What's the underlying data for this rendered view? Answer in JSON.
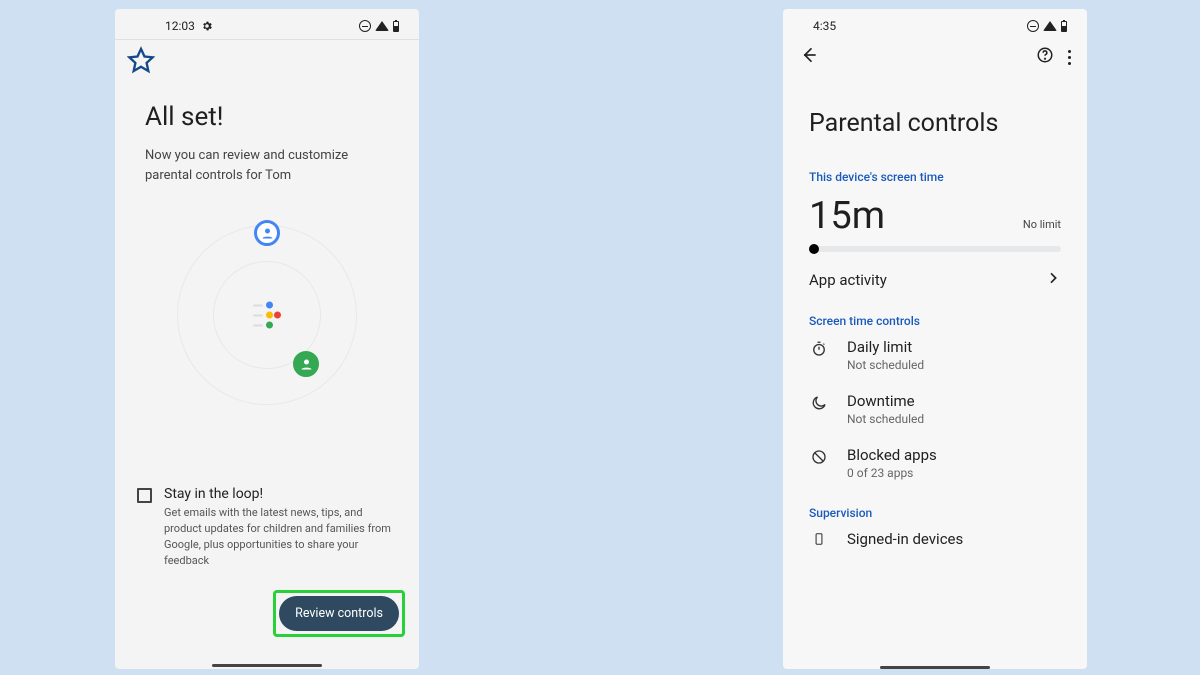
{
  "left": {
    "statusbar": {
      "time": "12:03"
    },
    "title": "All set!",
    "subtitle": "Now you can review and customize parental controls for Tom",
    "opt_in": {
      "heading": "Stay in the loop!",
      "body": "Get emails with the latest news, tips, and product updates for children and families from Google, plus opportunities to share your feedback"
    },
    "review_button": "Review controls"
  },
  "right": {
    "statusbar": {
      "time": "4:35"
    },
    "title": "Parental controls",
    "screen_time_label": "This device's screen time",
    "screen_time_value": "15m",
    "screen_time_limit": "No limit",
    "app_activity": "App activity",
    "controls_label": "Screen time controls",
    "controls": [
      {
        "title": "Daily limit",
        "subtitle": "Not scheduled"
      },
      {
        "title": "Downtime",
        "subtitle": "Not scheduled"
      },
      {
        "title": "Blocked apps",
        "subtitle": "0 of 23 apps"
      }
    ],
    "supervision_label": "Supervision",
    "signed_in": "Signed-in devices"
  }
}
